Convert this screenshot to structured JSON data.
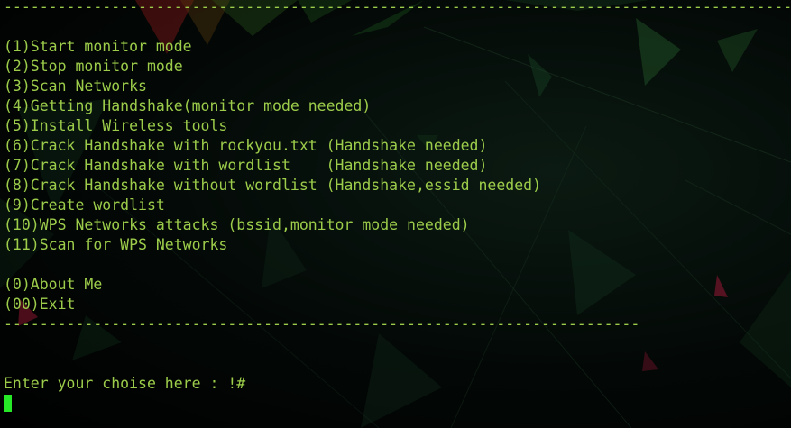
{
  "terminal": {
    "separator_top": "----------------------------------------------------------------------------------------",
    "menu": [
      "(1)Start monitor mode",
      "(2)Stop monitor mode",
      "(3)Scan Networks",
      "(4)Getting Handshake(monitor mode needed)",
      "(5)Install Wireless tools",
      "(6)Crack Handshake with rockyou.txt (Handshake needed)",
      "(7)Crack Handshake with wordlist    (Handshake needed)",
      "(8)Crack Handshake without wordlist (Handshake,essid needed)",
      "(9)Create wordlist",
      "(10)WPS Networks attacks (bssid,monitor mode needed)",
      "(11)Scan for WPS Networks"
    ],
    "extra": [
      "(0)About Me",
      "(00)Exit"
    ],
    "separator_bottom": "-----------------------------------------------------------------------",
    "prompt": "Enter your choise here : !#"
  },
  "colors": {
    "text": "#9ccc4a",
    "cursor": "#27e827",
    "background": "#000000"
  }
}
